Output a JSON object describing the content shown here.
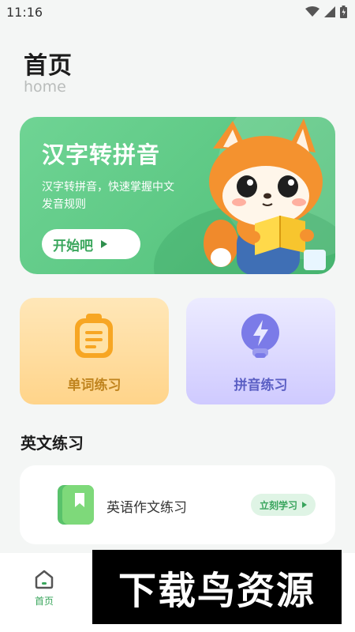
{
  "status_bar": {
    "time": "11:16",
    "icons": [
      "wifi-icon",
      "signal-icon",
      "battery-icon"
    ]
  },
  "header": {
    "title": "首页",
    "subtitle": "home"
  },
  "banner": {
    "title": "汉字转拼音",
    "description": "汉字转拼音，快速掌握中文发音规则",
    "button_label": "开始吧",
    "mascot": "fox-reading-book-illustration",
    "colors": {
      "bg": "#5ec785",
      "button_text": "#3aa65c"
    }
  },
  "cards": [
    {
      "label": "单词练习",
      "icon": "clipboard-icon",
      "color": "#f6a623"
    },
    {
      "label": "拼音练习",
      "icon": "lightbulb-bolt-icon",
      "color": "#6d6de0"
    }
  ],
  "section": {
    "title": "英文练习",
    "item": {
      "label": "英语作文练习",
      "icon": "green-book-icon",
      "button_label": "立刻学习"
    }
  },
  "bottom_nav": {
    "items": [
      {
        "label": "首页",
        "icon": "home-icon",
        "active": true
      }
    ]
  },
  "watermark": {
    "text": "下载鸟资源"
  }
}
